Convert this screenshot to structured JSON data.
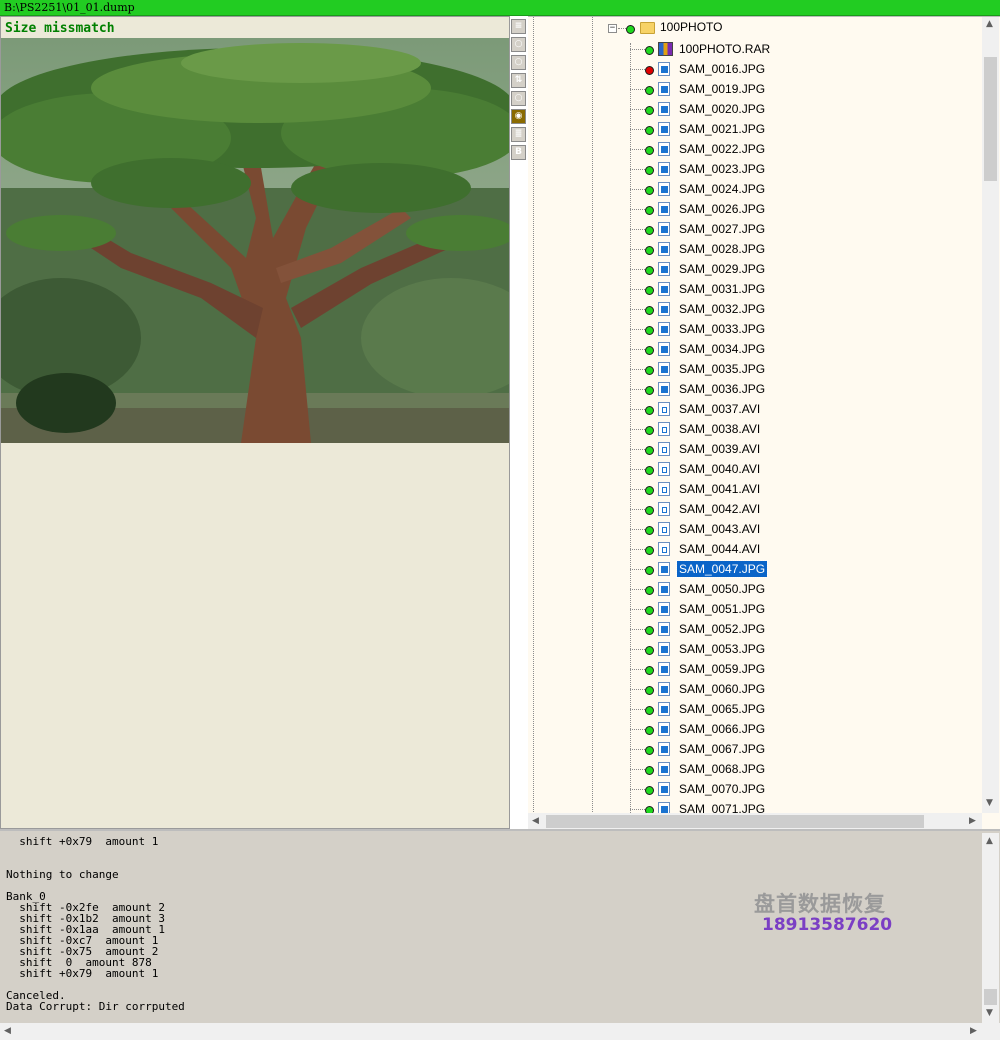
{
  "window": {
    "title": "B:\\PS2251\\01_01.dump"
  },
  "preview": {
    "status_text": "Size missmatch"
  },
  "toolbar": {
    "buttons": [
      {
        "icon": "list-icon"
      },
      {
        "icon": "pin-icon"
      },
      {
        "icon": "pin-icon"
      },
      {
        "icon": "swap-icon"
      },
      {
        "icon": "pin-icon"
      },
      {
        "icon": "eye-icon"
      },
      {
        "icon": "text-icon"
      },
      {
        "icon": "bold-icon",
        "label": "B"
      }
    ]
  },
  "tree": {
    "folder": {
      "name": "100PHOTO",
      "expander": "−",
      "status": "green"
    },
    "selected": "SAM_0047.JPG",
    "items": [
      {
        "name": "100PHOTO.RAR",
        "status": "green",
        "type": "rar"
      },
      {
        "name": "SAM_0016.JPG",
        "status": "red",
        "type": "image"
      },
      {
        "name": "SAM_0019.JPG",
        "status": "green",
        "type": "image"
      },
      {
        "name": "SAM_0020.JPG",
        "status": "green",
        "type": "image"
      },
      {
        "name": "SAM_0021.JPG",
        "status": "green",
        "type": "image"
      },
      {
        "name": "SAM_0022.JPG",
        "status": "green",
        "type": "image"
      },
      {
        "name": "SAM_0023.JPG",
        "status": "green",
        "type": "image"
      },
      {
        "name": "SAM_0024.JPG",
        "status": "green",
        "type": "image"
      },
      {
        "name": "SAM_0026.JPG",
        "status": "green",
        "type": "image"
      },
      {
        "name": "SAM_0027.JPG",
        "status": "green",
        "type": "image"
      },
      {
        "name": "SAM_0028.JPG",
        "status": "green",
        "type": "image"
      },
      {
        "name": "SAM_0029.JPG",
        "status": "green",
        "type": "image"
      },
      {
        "name": "SAM_0031.JPG",
        "status": "green",
        "type": "image"
      },
      {
        "name": "SAM_0032.JPG",
        "status": "green",
        "type": "image"
      },
      {
        "name": "SAM_0033.JPG",
        "status": "green",
        "type": "image"
      },
      {
        "name": "SAM_0034.JPG",
        "status": "green",
        "type": "image"
      },
      {
        "name": "SAM_0035.JPG",
        "status": "green",
        "type": "image"
      },
      {
        "name": "SAM_0036.JPG",
        "status": "green",
        "type": "image"
      },
      {
        "name": "SAM_0037.AVI",
        "status": "green",
        "type": "video"
      },
      {
        "name": "SAM_0038.AVI",
        "status": "green",
        "type": "video"
      },
      {
        "name": "SAM_0039.AVI",
        "status": "green",
        "type": "video"
      },
      {
        "name": "SAM_0040.AVI",
        "status": "green",
        "type": "video"
      },
      {
        "name": "SAM_0041.AVI",
        "status": "green",
        "type": "video"
      },
      {
        "name": "SAM_0042.AVI",
        "status": "green",
        "type": "video"
      },
      {
        "name": "SAM_0043.AVI",
        "status": "green",
        "type": "video"
      },
      {
        "name": "SAM_0044.AVI",
        "status": "green",
        "type": "video"
      },
      {
        "name": "SAM_0047.JPG",
        "status": "green",
        "type": "image"
      },
      {
        "name": "SAM_0050.JPG",
        "status": "green",
        "type": "image"
      },
      {
        "name": "SAM_0051.JPG",
        "status": "green",
        "type": "image"
      },
      {
        "name": "SAM_0052.JPG",
        "status": "green",
        "type": "image"
      },
      {
        "name": "SAM_0053.JPG",
        "status": "green",
        "type": "image"
      },
      {
        "name": "SAM_0059.JPG",
        "status": "green",
        "type": "image"
      },
      {
        "name": "SAM_0060.JPG",
        "status": "green",
        "type": "image"
      },
      {
        "name": "SAM_0065.JPG",
        "status": "green",
        "type": "image"
      },
      {
        "name": "SAM_0066.JPG",
        "status": "green",
        "type": "image"
      },
      {
        "name": "SAM_0067.JPG",
        "status": "green",
        "type": "image"
      },
      {
        "name": "SAM_0068.JPG",
        "status": "green",
        "type": "image"
      },
      {
        "name": "SAM_0070.JPG",
        "status": "green",
        "type": "image"
      },
      {
        "name": "SAM_0071.JPG",
        "status": "green",
        "type": "image"
      }
    ]
  },
  "log": {
    "lines": [
      "  shift +0x79  amount 1",
      "",
      "",
      "Nothing to change",
      "",
      "Bank_0",
      "  shift -0x2fe  amount 2",
      "  shift -0x1b2  amount 3",
      "  shift -0x1aa  amount 1",
      "  shift -0xc7  amount 1",
      "  shift -0x75  amount 2",
      "  shift  0  amount 878",
      "  shift +0x79  amount 1",
      "",
      "Canceled.",
      "Data Corrupt: Dir corrputed"
    ]
  },
  "watermark": {
    "company": "盘首数据恢复",
    "phone": "18913587620"
  },
  "colors": {
    "title_bar": "#22cc22",
    "status_text": "#008000",
    "selection": "#0a64c8",
    "ok_dot": "#1ed81e",
    "bad_dot": "#e00000",
    "phone": "#7b3fc4"
  }
}
